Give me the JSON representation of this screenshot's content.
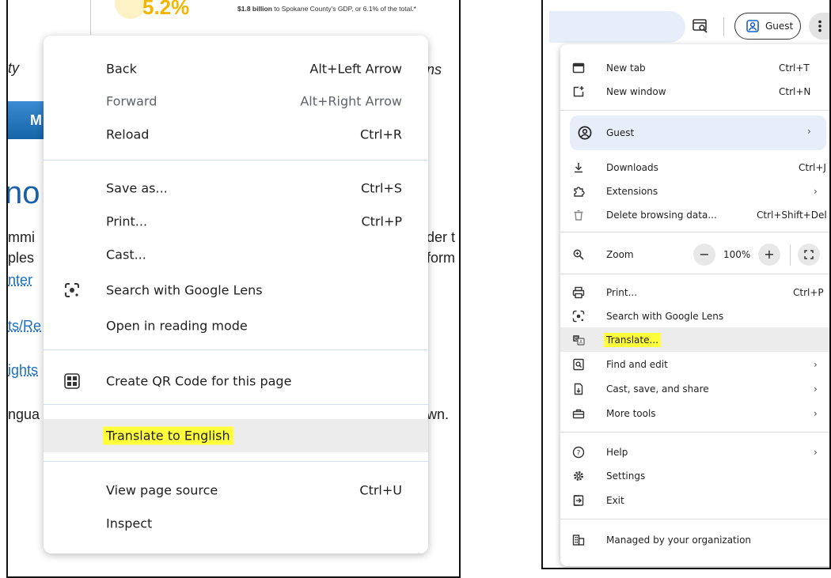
{
  "page_bg": {
    "stat_value": "5.2%",
    "stat_desc_bold": "$1.8 billion",
    "stat_desc": " to Spokane County's GDP, or 6.1% of the total.*",
    "frag_left_1": "ty",
    "frag_right_1": "ns",
    "button_frag": "M",
    "heading_frag": "no",
    "frag_left_3": "mmi",
    "frag_right_3": "der t",
    "frag_left_4": "ples",
    "frag_right_4": "form",
    "frag_left_5": "nter",
    "frag_left_6": "ts/Re",
    "frag_left_7": "ights",
    "frag_left_8": "ngua",
    "frag_right_8": "wn."
  },
  "context_menu": {
    "back": {
      "label": "Back",
      "shortcut": "Alt+Left Arrow"
    },
    "forward": {
      "label": "Forward",
      "shortcut": "Alt+Right Arrow"
    },
    "reload": {
      "label": "Reload",
      "shortcut": "Ctrl+R"
    },
    "save_as": {
      "label": "Save as...",
      "shortcut": "Ctrl+S"
    },
    "print": {
      "label": "Print...",
      "shortcut": "Ctrl+P"
    },
    "cast": {
      "label": "Cast..."
    },
    "lens": {
      "label": "Search with Google Lens"
    },
    "reading": {
      "label": "Open in reading mode"
    },
    "qr": {
      "label": "Create QR Code for this page"
    },
    "translate": {
      "label": "Translate to English"
    },
    "source": {
      "label": "View page source",
      "shortcut": "Ctrl+U"
    },
    "inspect": {
      "label": "Inspect"
    }
  },
  "toolbar": {
    "guest_label": "Guest"
  },
  "chrome_menu": {
    "new_tab": {
      "label": "New tab",
      "shortcut": "Ctrl+T"
    },
    "new_window": {
      "label": "New window",
      "shortcut": "Ctrl+N"
    },
    "guest": {
      "label": "Guest"
    },
    "downloads": {
      "label": "Downloads",
      "shortcut": "Ctrl+J"
    },
    "extensions": {
      "label": "Extensions"
    },
    "delete_data": {
      "label": "Delete browsing data...",
      "shortcut": "Ctrl+Shift+Del"
    },
    "zoom": {
      "label": "Zoom",
      "value": "100%"
    },
    "print": {
      "label": "Print...",
      "shortcut": "Ctrl+P"
    },
    "lens": {
      "label": "Search with Google Lens"
    },
    "translate": {
      "label": "Translate..."
    },
    "find_edit": {
      "label": "Find and edit"
    },
    "cast_save": {
      "label": "Cast, save, and share"
    },
    "more_tools": {
      "label": "More tools"
    },
    "help": {
      "label": "Help"
    },
    "settings": {
      "label": "Settings"
    },
    "exit": {
      "label": "Exit"
    },
    "managed": {
      "label": "Managed by your organization"
    }
  },
  "colors": {
    "highlight": "#ffff3c",
    "accent_blue": "#e8eef9",
    "stat_yellow": "#f2b600"
  }
}
